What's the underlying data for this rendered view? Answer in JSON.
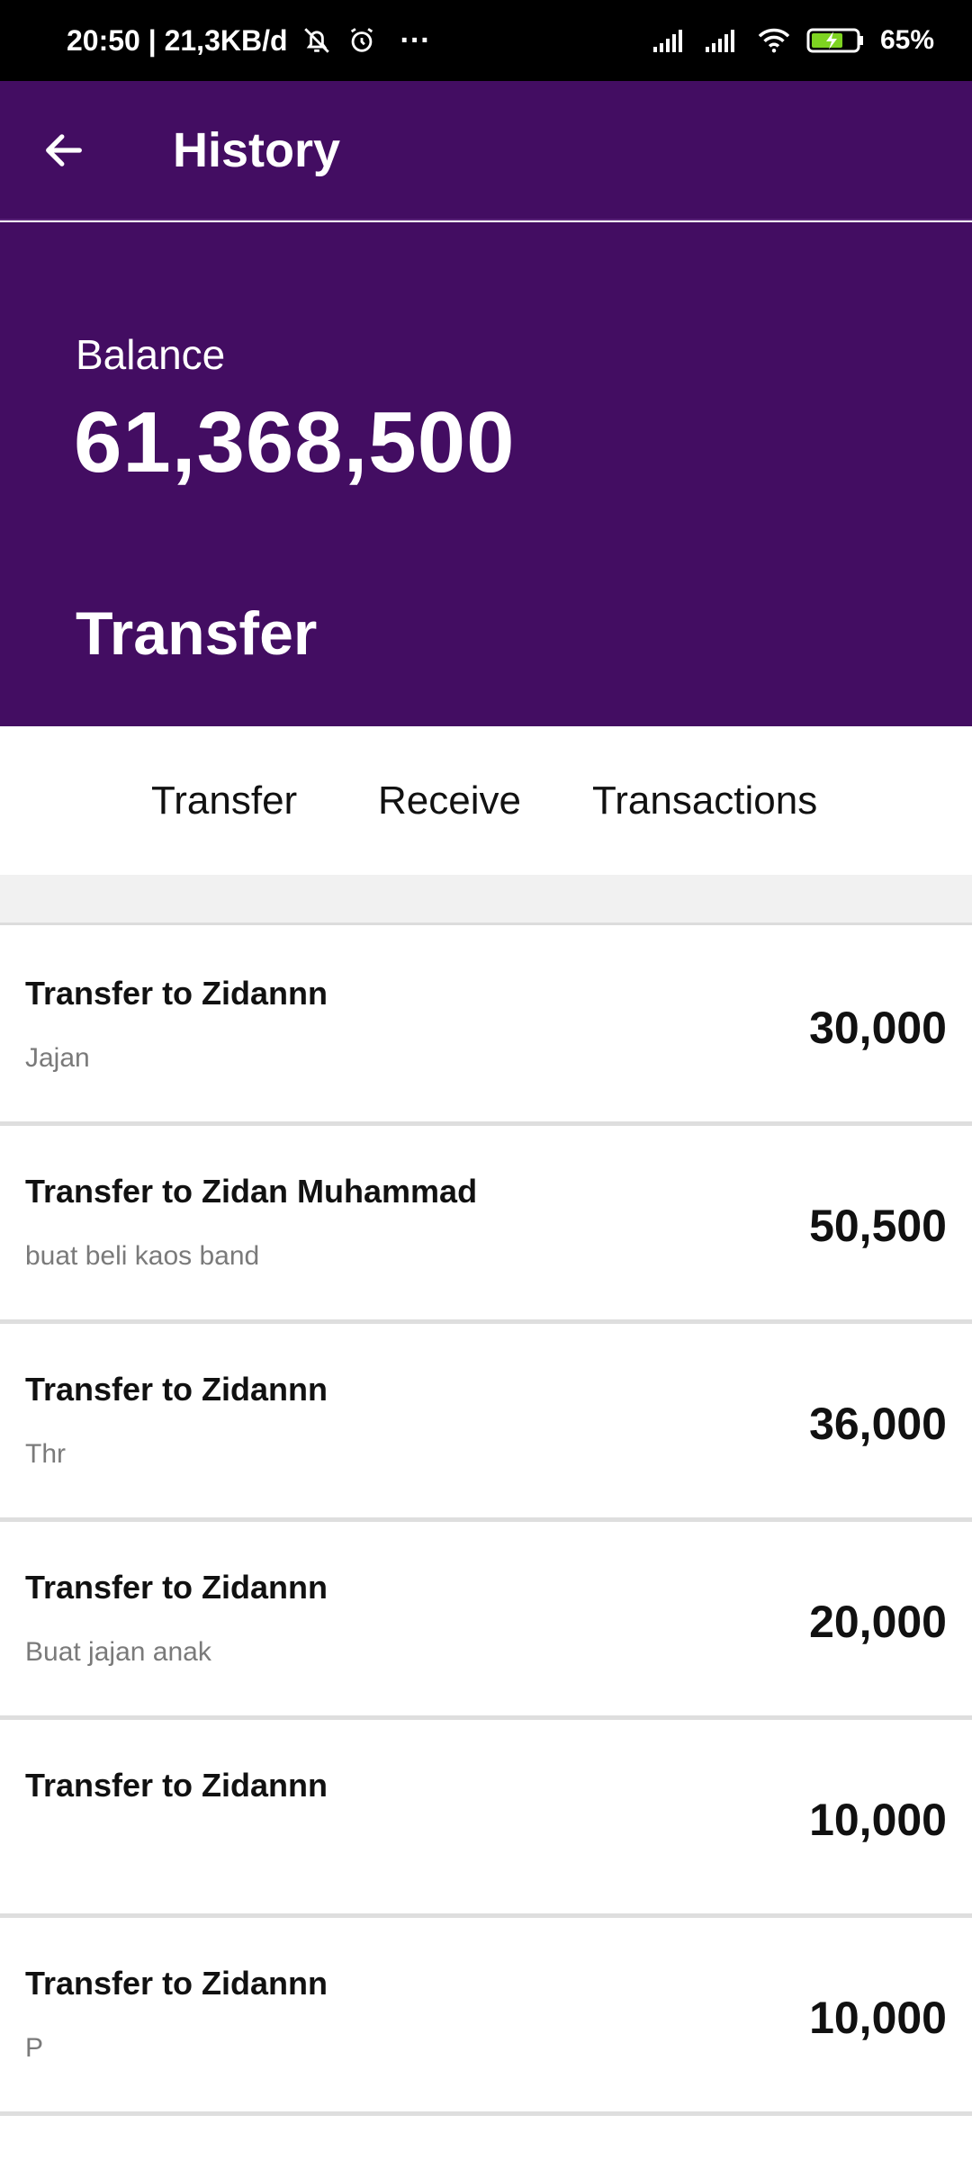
{
  "status_bar": {
    "time_and_speed": "20:50 | 21,3KB/d",
    "more": "···",
    "battery": "65%"
  },
  "header": {
    "title": "History"
  },
  "hero": {
    "balance_label": "Balance",
    "balance_value": "61,368,500",
    "section_title": "Transfer"
  },
  "tabs": [
    {
      "label": "Transfer"
    },
    {
      "label": "Receive"
    },
    {
      "label": "Transactions"
    }
  ],
  "transactions": [
    {
      "title": "Transfer to Zidannn",
      "note": "Jajan",
      "amount": "30,000"
    },
    {
      "title": "Transfer to Zidan Muhammad",
      "note": "buat beli kaos band",
      "amount": "50,500"
    },
    {
      "title": "Transfer to Zidannn",
      "note": "Thr",
      "amount": "36,000"
    },
    {
      "title": "Transfer to Zidannn",
      "note": "Buat jajan anak",
      "amount": "20,000"
    },
    {
      "title": "Transfer to Zidannn",
      "note": "",
      "amount": "10,000"
    },
    {
      "title": "Transfer to Zidannn",
      "note": "P",
      "amount": "10,000"
    }
  ],
  "colors": {
    "brand": "#430d62",
    "divider": "#dedede",
    "muted_text": "#7a7a7a"
  },
  "icons": {
    "back": "arrow-left-icon",
    "mute": "bell-off-icon",
    "alarm": "alarm-icon",
    "signal": "signal-icon",
    "wifi": "wifi-icon",
    "battery": "battery-charging-icon"
  }
}
